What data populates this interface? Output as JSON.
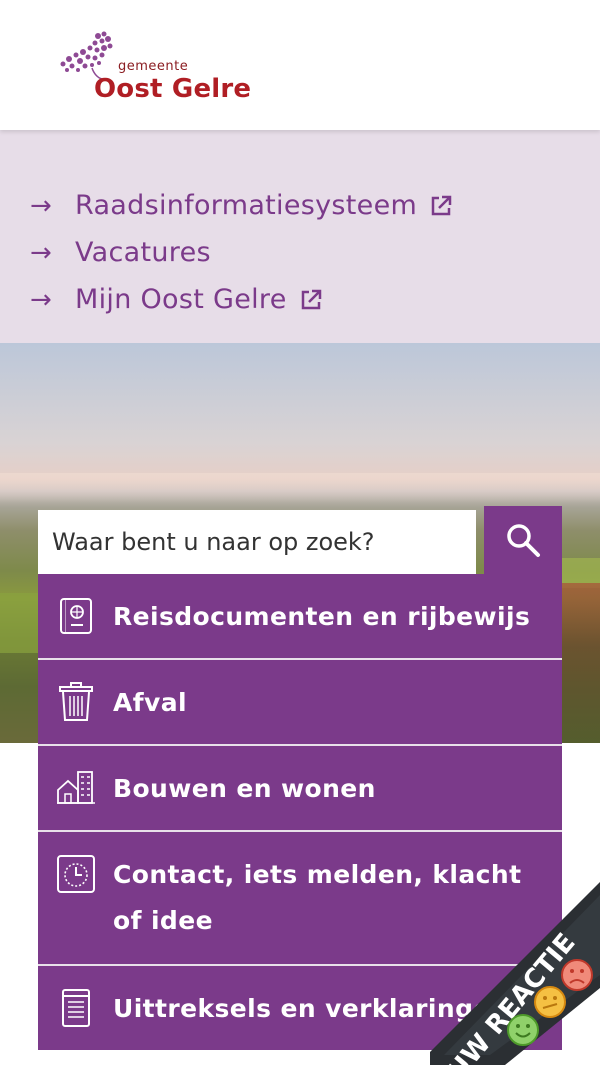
{
  "header": {
    "logo_top": "gemeente",
    "logo_name": "Oost Gelre"
  },
  "quick_links": [
    {
      "label": "Raadsinformatiesysteem",
      "external": true
    },
    {
      "label": "Vacatures",
      "external": false
    },
    {
      "label": "Mijn Oost Gelre",
      "external": true
    }
  ],
  "arrow_glyph": "→",
  "search": {
    "placeholder": "Waar bent u naar op zoek?",
    "icon": "search-icon"
  },
  "menu": [
    {
      "label": "Reisdocumenten en rijbewijs",
      "icon": "passport-icon"
    },
    {
      "label": "Afval",
      "icon": "trash-bin-icon"
    },
    {
      "label": "Bouwen en wonen",
      "icon": "buildings-icon"
    },
    {
      "label": "Contact, iets melden, klacht of idee",
      "icon": "clock-icon"
    },
    {
      "label": "Uittreksels en verklaringen",
      "icon": "document-icon"
    }
  ],
  "feedback_badge": {
    "label": "UW REACTIE"
  },
  "colors": {
    "brand_purple": "#7b3a8a",
    "links_bg": "#e7dde8",
    "logo_red": "#b01e24"
  }
}
